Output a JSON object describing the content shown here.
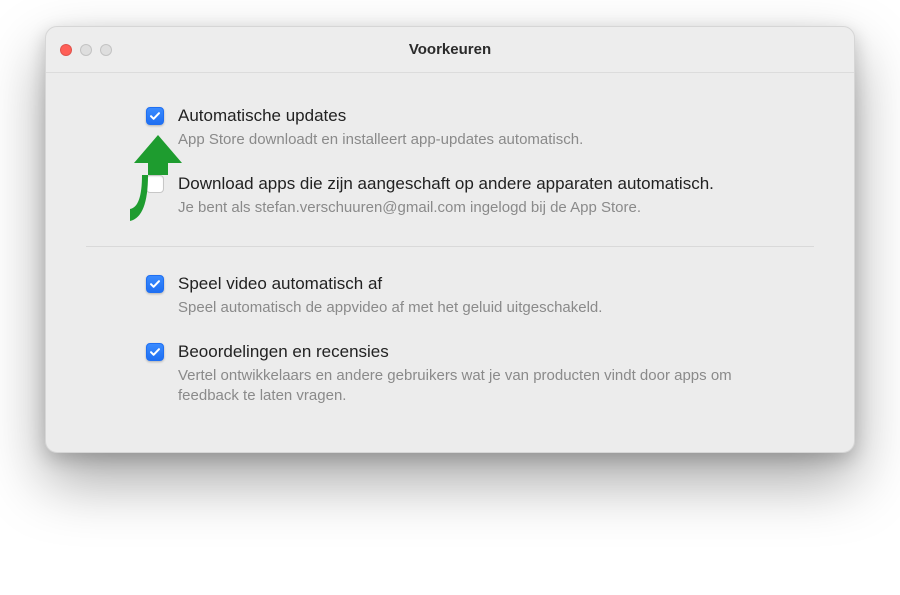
{
  "window": {
    "title": "Voorkeuren"
  },
  "prefs": {
    "autoUpdates": {
      "checked": true,
      "label": "Automatische updates",
      "desc": "App Store downloadt en installeert app-updates automatisch."
    },
    "autoDownload": {
      "checked": false,
      "label": "Download apps die zijn aangeschaft op andere apparaten automatisch.",
      "desc": "Je bent als stefan.verschuuren@gmail.com ingelogd bij de App Store."
    },
    "autoplay": {
      "checked": true,
      "label": "Speel video automatisch af",
      "desc": "Speel automatisch de appvideo af met het geluid uitgeschakeld."
    },
    "reviews": {
      "checked": true,
      "label": "Beoordelingen en recensies",
      "desc": "Vertel ontwikkelaars en andere gebruikers wat je van producten vindt door apps om feedback te laten vragen."
    }
  },
  "annotation": {
    "type": "arrow",
    "color": "#1e9c2f"
  }
}
